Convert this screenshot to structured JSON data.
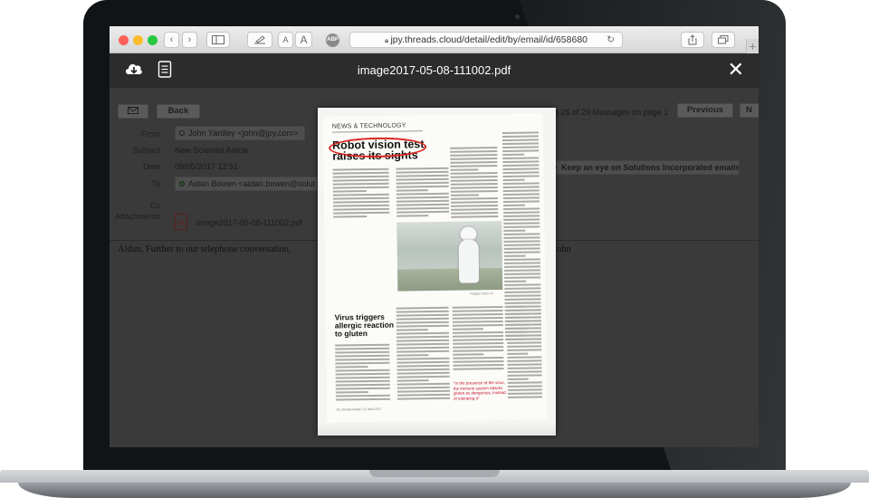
{
  "browser": {
    "url": "jpy.threads.cloud/detail/edit/by/email/id/658680",
    "font_small_label": "A",
    "font_large_label": "A",
    "adblock_label": "ABP",
    "new_tab_label": "+"
  },
  "viewer": {
    "title": "image2017-05-08-111002.pdf",
    "download_icon": "cloud-download-icon",
    "document_icon": "document-icon",
    "close_label": "✕"
  },
  "email": {
    "back_label": "Back",
    "pagination_text": "ng 26 of 29 Messages on page 1",
    "previous_label": "Previous",
    "next_label_partial": "N",
    "from_label": "From",
    "from_value": "John Yardley <john@jpy.com>",
    "subject_label": "Subject",
    "subject_value": "New Scientist Article",
    "date_label": "Date",
    "date_value": "09/05/2017  12:51",
    "to_label": "To",
    "to_value": "Aidan Bowen <aidan.bowen@solut",
    "cc_label": "Cc",
    "attachments_label": "Attachments",
    "attachment_name": "image2017-05-08-111002.pdf",
    "keep_eye_label": "Keep an eye on Solutions Incorporated emails",
    "body_text_left": "Aidan, Further to our telephone conversation,",
    "body_text_right": "ohn"
  },
  "pdf": {
    "section": "NEWS & TECHNOLOGY",
    "headline": "Robot vision test raises its sights",
    "subhead": "Virus triggers allergic reaction to gluten",
    "pull_quote": "\"In the presence of the virus, the immune system attacks gluten as dangerous, instead of tolerating it\"",
    "photo_caption": "Pepper looks on",
    "footer": "16 | NewScientist | 22 April 2017",
    "highlight_color": "#d9241c"
  }
}
